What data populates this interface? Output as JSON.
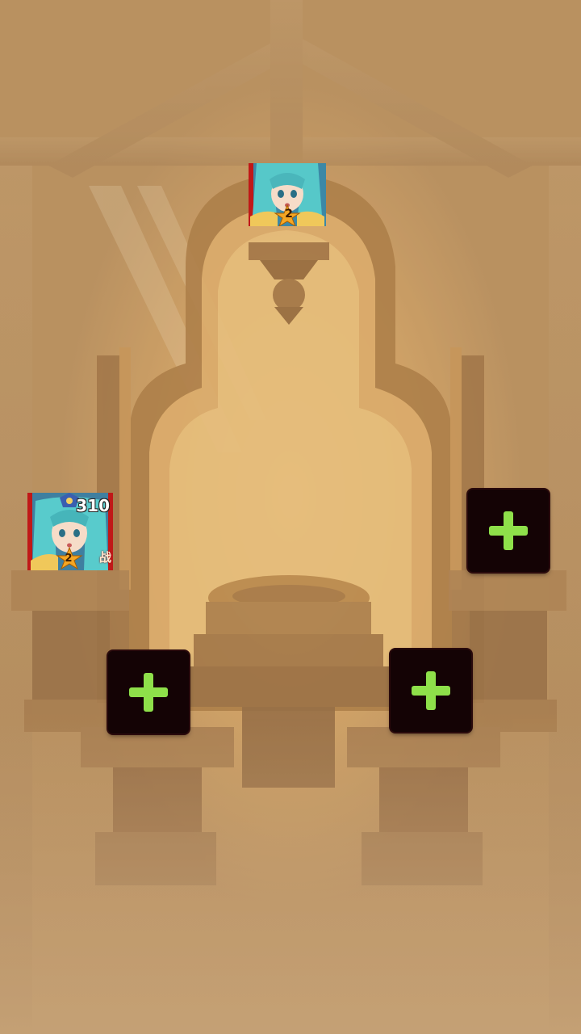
{
  "scene": {
    "name": "throne-formation",
    "colors": {
      "background": "#b9905e",
      "glow": "#f3c778",
      "slot_bg": "#140305",
      "plus": "#8ee04a"
    }
  },
  "heroes": [
    {
      "id": "hero-top",
      "level": "2",
      "power": ""
    },
    {
      "id": "hero-left",
      "level": "2",
      "power": "310",
      "side_tag": "战"
    }
  ],
  "slots": [
    {
      "id": "slot-right",
      "icon": "plus-icon"
    },
    {
      "id": "slot-mid-left",
      "icon": "plus-icon"
    },
    {
      "id": "slot-mid-right",
      "icon": "plus-icon"
    }
  ]
}
